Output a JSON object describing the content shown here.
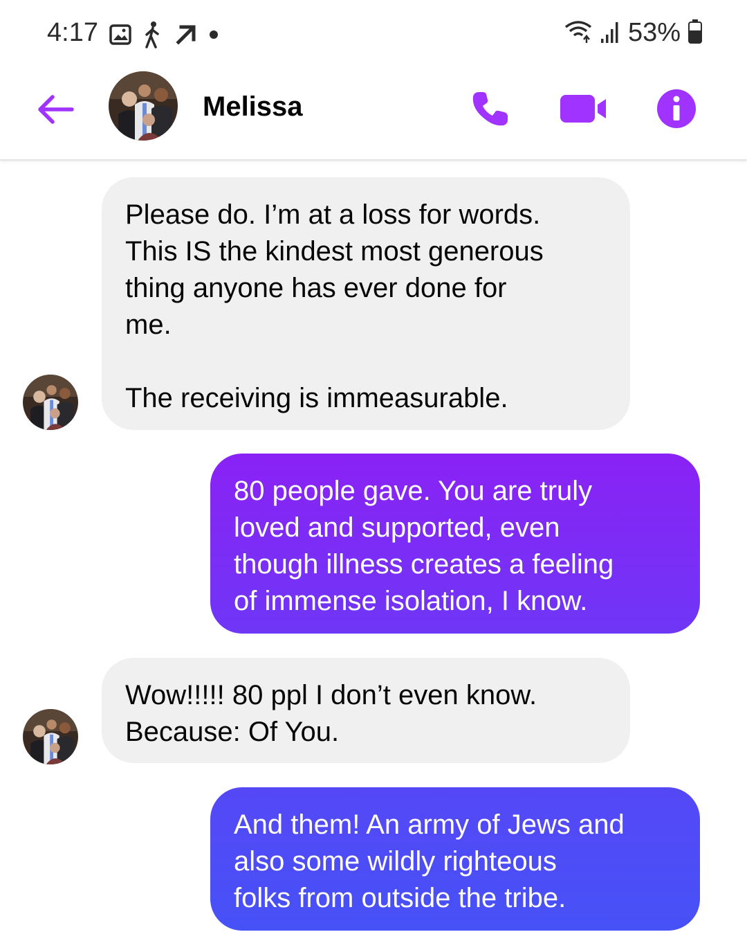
{
  "status_bar": {
    "time": "4:17",
    "battery": "53%",
    "left_icons": [
      "gallery-icon",
      "walking-icon",
      "navigation-arrow-icon",
      "dot-icon"
    ],
    "right_icons": [
      "wifi-icon",
      "signal-icon",
      "battery-icon"
    ]
  },
  "header": {
    "contact_name": "Melissa",
    "accent_color": "#a033ff",
    "icons": [
      "back-arrow-icon",
      "phone-icon",
      "video-icon",
      "info-icon"
    ]
  },
  "messages": [
    {
      "direction": "incoming",
      "text": "Please do. I’m at a loss for words.\nThis IS the kindest most generous\nthing anyone has ever done for\nme.\n\nThe receiving is immeasurable."
    },
    {
      "direction": "outgoing",
      "text": "80 people gave. You are truly\nloved and supported, even\nthough illness creates a feeling\nof immense isolation, I know.",
      "color": "#7b2cf6"
    },
    {
      "direction": "incoming",
      "text": "Wow!!!!! 80 ppl I don’t even know.\nBecause: Of You."
    },
    {
      "direction": "outgoing",
      "text": "And them! An army of Jews and\nalso some wildly righteous\nfolks from outside the tribe.",
      "color": "#4b4ef6"
    }
  ]
}
